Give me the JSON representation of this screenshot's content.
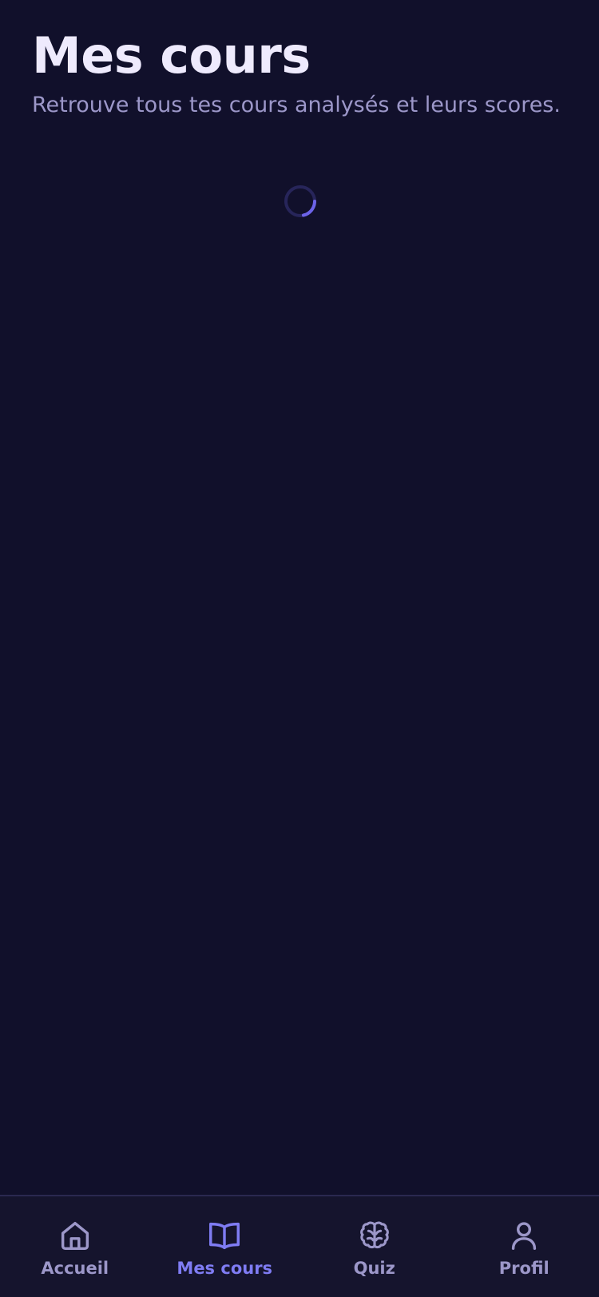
{
  "header": {
    "title": "Mes cours",
    "subtitle": "Retrouve tous tes cours analysés et leurs scores."
  },
  "loading": {
    "icon": "loading-spinner-icon",
    "accent_color": "#6c63e8"
  },
  "tabbar": {
    "active": "Mes cours",
    "items": [
      {
        "label": "Accueil",
        "icon": "home-icon"
      },
      {
        "label": "Mes cours",
        "icon": "book-open-icon"
      },
      {
        "label": "Quiz",
        "icon": "brain-icon"
      },
      {
        "label": "Profil",
        "icon": "user-icon"
      }
    ]
  },
  "colors": {
    "background": "#11102b",
    "tabbar_background": "#15142d",
    "active_tab": "#7f7cf3",
    "inactive_tab": "#9c97c9",
    "title": "#eeeafd"
  }
}
